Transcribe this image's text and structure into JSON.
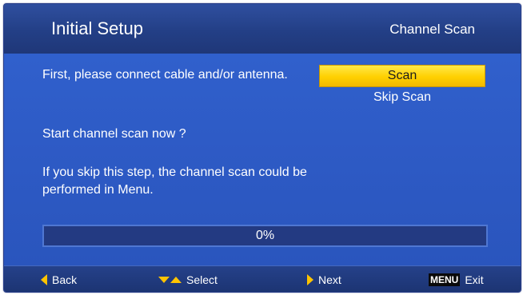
{
  "header": {
    "title": "Initial Setup",
    "section": "Channel Scan"
  },
  "instructions": {
    "line1": "First, please connect cable and/or antenna.",
    "line2": "Start channel scan now ?",
    "line3": "If you skip this step, the channel scan could be performed in Menu."
  },
  "menu": {
    "items": [
      {
        "label": "Scan",
        "selected": true
      },
      {
        "label": "Skip Scan",
        "selected": false
      }
    ]
  },
  "progress": {
    "value": 0,
    "label": "0%"
  },
  "footer": {
    "back": "Back",
    "select": "Select",
    "next": "Next",
    "menu_key": "MENU",
    "exit": "Exit"
  },
  "colors": {
    "background": "#2e58c4",
    "highlight": "#ffd000",
    "accent_icon": "#ffc400"
  }
}
